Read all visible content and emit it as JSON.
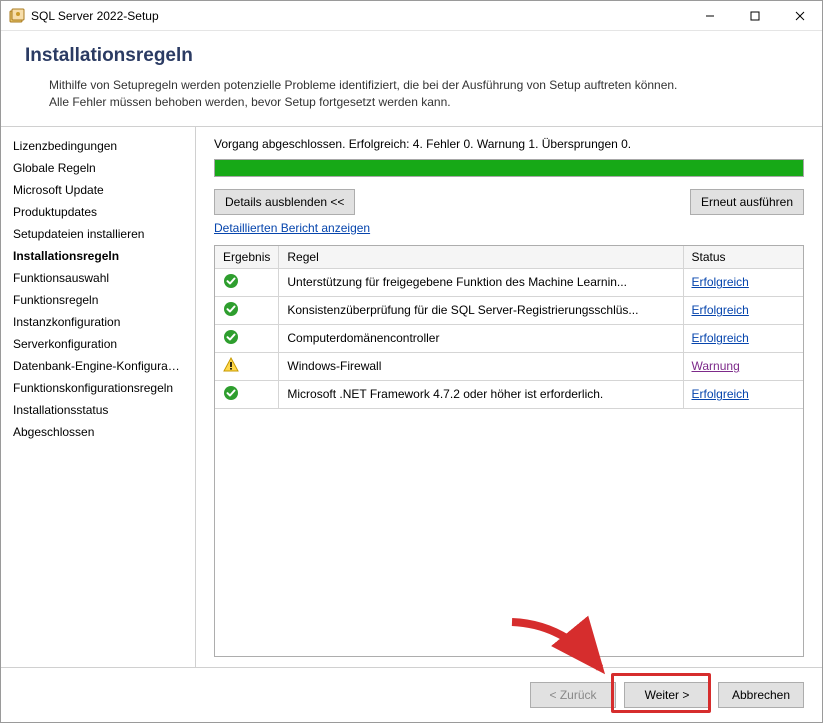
{
  "window": {
    "title": "SQL Server 2022-Setup"
  },
  "header": {
    "title": "Installationsregeln",
    "desc_line1": "Mithilfe von Setupregeln werden potenzielle Probleme identifiziert, die bei der Ausführung von Setup auftreten können.",
    "desc_line2": "Alle Fehler müssen behoben werden, bevor Setup fortgesetzt werden kann."
  },
  "sidebar": {
    "steps": [
      {
        "label": "Lizenzbedingungen"
      },
      {
        "label": "Globale Regeln"
      },
      {
        "label": "Microsoft Update"
      },
      {
        "label": "Produktupdates"
      },
      {
        "label": "Setupdateien installieren"
      },
      {
        "label": "Installationsregeln",
        "active": true
      },
      {
        "label": "Funktionsauswahl"
      },
      {
        "label": "Funktionsregeln"
      },
      {
        "label": "Instanzkonfiguration"
      },
      {
        "label": "Serverkonfiguration"
      },
      {
        "label": "Datenbank-Engine-Konfigurati..."
      },
      {
        "label": "Funktionskonfigurationsregeln"
      },
      {
        "label": "Installationsstatus"
      },
      {
        "label": "Abgeschlossen"
      }
    ]
  },
  "main": {
    "status_text": "Vorgang abgeschlossen. Erfolgreich: 4. Fehler 0. Warnung 1. Übersprungen 0.",
    "progress_pct": 100,
    "details_button": "Details ausblenden <<",
    "rerun_button": "Erneut ausführen",
    "report_link": "Detaillierten Bericht anzeigen",
    "columns": {
      "result": "Ergebnis",
      "rule": "Regel",
      "status": "Status"
    },
    "rows": [
      {
        "result": "ok",
        "rule": "Unterstützung für freigegebene Funktion des Machine Learnin...",
        "status": "Erfolgreich",
        "status_kind": "ok"
      },
      {
        "result": "ok",
        "rule": "Konsistenzüberprüfung für die SQL Server-Registrierungsschlüs...",
        "status": "Erfolgreich",
        "status_kind": "ok"
      },
      {
        "result": "ok",
        "rule": "Computerdomänencontroller",
        "status": "Erfolgreich",
        "status_kind": "ok"
      },
      {
        "result": "warn",
        "rule": "Windows-Firewall",
        "status": "Warnung",
        "status_kind": "warn"
      },
      {
        "result": "ok",
        "rule": "Microsoft .NET Framework 4.7.2 oder höher ist erforderlich.",
        "status": "Erfolgreich",
        "status_kind": "ok"
      }
    ]
  },
  "footer": {
    "back": "< Zurück",
    "next": "Weiter >",
    "cancel": "Abbrechen"
  }
}
